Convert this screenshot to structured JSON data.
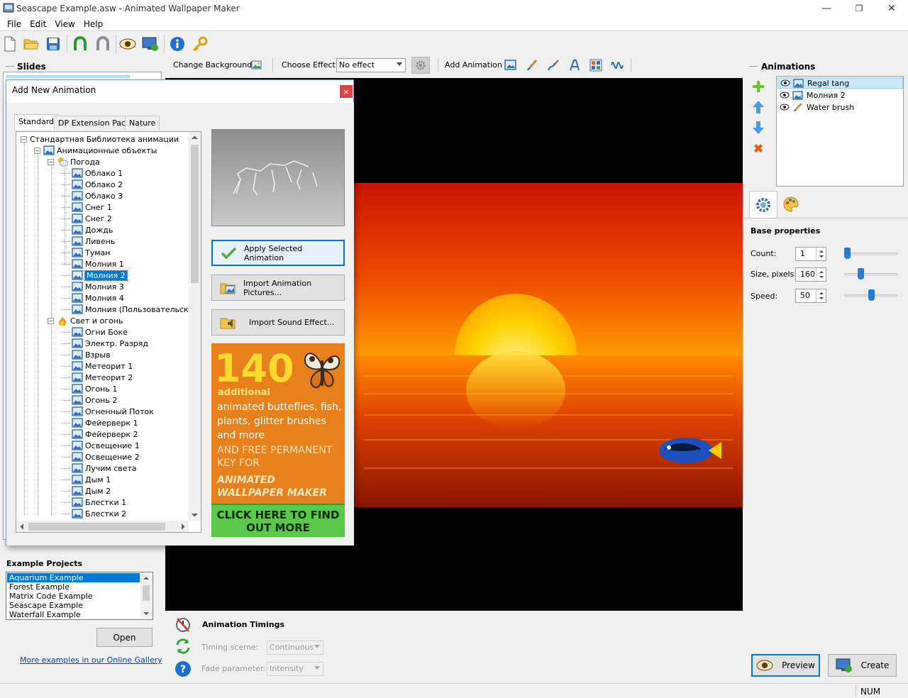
{
  "window": {
    "title": "Seascape Example.asw - Animated Wallpaper Maker"
  },
  "menu": [
    "File",
    "Edit",
    "View",
    "Help"
  ],
  "slides": {
    "title": "Slides"
  },
  "effect_bar": {
    "change_background": "Change Background",
    "choose_effect_label": "Choose Effect:",
    "effect_value": "No effect",
    "add_animation": "Add Animation"
  },
  "animations": {
    "title": "Animations",
    "items": [
      {
        "label": "Regal tang",
        "selected": true,
        "icon": "picture-icon"
      },
      {
        "label": "Молния 2",
        "selected": false,
        "icon": "picture-icon"
      },
      {
        "label": "Water brush",
        "selected": false,
        "icon": "brush-icon"
      }
    ]
  },
  "properties": {
    "title": "Base properties",
    "count_label": "Count:",
    "count_value": "1",
    "count_level": 0.05,
    "size_label": "Size, pixels:",
    "size_value": "160",
    "size_level": 0.3,
    "speed_label": "Speed:",
    "speed_value": "50",
    "speed_level": 0.5
  },
  "timings": {
    "title": "Animation Timings",
    "scheme_label": "Timing sceme:",
    "scheme_value": "Continuous",
    "fade_label": "Fade parameter:",
    "fade_value": "Intensity"
  },
  "actions": {
    "preview": "Preview",
    "create": "Create"
  },
  "examples": {
    "title": "Example Projects",
    "items": [
      "Aquarium Example",
      "Forest Example",
      "Matrix Code Example",
      "Seascape Example",
      "Waterfall Example"
    ],
    "selected": 0,
    "open": "Open",
    "gallery_link": "More examples in our Online Gallery"
  },
  "status": {
    "num": "NUM"
  },
  "dialog": {
    "title": "Add New Animation",
    "close": "×",
    "tabs": [
      "Standard",
      "DP Extension Pack",
      "Nature"
    ],
    "tree": [
      {
        "label": "Стандартная Библиотека анимации",
        "level": 0,
        "type": "root",
        "expander": "−"
      },
      {
        "label": "Анимационные объекты",
        "level": 1,
        "type": "folder",
        "expander": "−"
      },
      {
        "label": "Погода",
        "level": 2,
        "type": "weather",
        "expander": "−"
      },
      {
        "label": "Облако 1",
        "level": 3,
        "type": "item"
      },
      {
        "label": "Облако 2",
        "level": 3,
        "type": "item"
      },
      {
        "label": "Облако 3",
        "level": 3,
        "type": "item"
      },
      {
        "label": "Снег 1",
        "level": 3,
        "type": "item"
      },
      {
        "label": "Снег 2",
        "level": 3,
        "type": "item"
      },
      {
        "label": "Дождь",
        "level": 3,
        "type": "item"
      },
      {
        "label": "Ливень",
        "level": 3,
        "type": "item"
      },
      {
        "label": "Туман",
        "level": 3,
        "type": "item"
      },
      {
        "label": "Молния 1",
        "level": 3,
        "type": "item"
      },
      {
        "label": "Молния 2",
        "level": 3,
        "type": "item",
        "selected": true
      },
      {
        "label": "Молния 3",
        "level": 3,
        "type": "item"
      },
      {
        "label": "Молния 4",
        "level": 3,
        "type": "item"
      },
      {
        "label": "Молния (Пользовательская)",
        "level": 3,
        "type": "item"
      },
      {
        "label": "Свет и огонь",
        "level": 2,
        "type": "fire",
        "expander": "−"
      },
      {
        "label": "Огни Боке",
        "level": 3,
        "type": "item"
      },
      {
        "label": "Электр. Разряд",
        "level": 3,
        "type": "item"
      },
      {
        "label": "Взрыв",
        "level": 3,
        "type": "item"
      },
      {
        "label": "Метеорит 1",
        "level": 3,
        "type": "item"
      },
      {
        "label": "Метеорит 2",
        "level": 3,
        "type": "item"
      },
      {
        "label": "Огонь 1",
        "level": 3,
        "type": "item"
      },
      {
        "label": "Огонь 2",
        "level": 3,
        "type": "item"
      },
      {
        "label": "Огненный Поток",
        "level": 3,
        "type": "item"
      },
      {
        "label": "Фейерверк 1",
        "level": 3,
        "type": "item"
      },
      {
        "label": "Фейерверк 2",
        "level": 3,
        "type": "item"
      },
      {
        "label": "Освещение 1",
        "level": 3,
        "type": "item"
      },
      {
        "label": "Освещение 2",
        "level": 3,
        "type": "item"
      },
      {
        "label": "Лучим света",
        "level": 3,
        "type": "item"
      },
      {
        "label": "Дым 1",
        "level": 3,
        "type": "item"
      },
      {
        "label": "Дым 2",
        "level": 3,
        "type": "item"
      },
      {
        "label": "Блестки 1",
        "level": 3,
        "type": "item"
      },
      {
        "label": "Блестки 2",
        "level": 3,
        "type": "item"
      }
    ],
    "apply": "Apply Selected Animation",
    "import_pictures": "Import Animation Pictures...",
    "import_sound": "Import Sound Effect...",
    "promo": {
      "number": "140",
      "additional": "additional",
      "desc": "animated butteflies, fish, plants, glitter brushes and more",
      "free": "AND FREE PERMANENT KEY FOR",
      "brand": "ANIMATED WALLPAPER MAKER",
      "cta": "CLICK HERE TO FIND OUT MORE"
    }
  },
  "colors": {
    "accent": "#0078d7",
    "promo_orange": "#e8801c",
    "promo_green": "#5ac94a",
    "sun": "#ffd700",
    "sky": "#d41a00"
  }
}
